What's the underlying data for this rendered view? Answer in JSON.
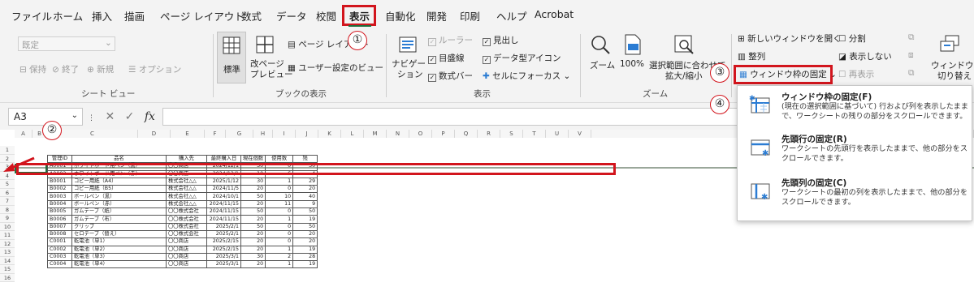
{
  "menubar": {
    "items": [
      "ファイル",
      "ホーム",
      "挿入",
      "描画",
      "ページ レイアウト",
      "数式",
      "データ",
      "校閲",
      "表示",
      "自動化",
      "開発",
      "印刷",
      "ヘルプ",
      "Acrobat"
    ],
    "active": "表示"
  },
  "ribbon": {
    "sheetview": {
      "dropdown": "既定",
      "keep": "保持",
      "exit": "終了",
      "new": "新規",
      "options": "オプション",
      "label": "シート ビュー"
    },
    "bookview": {
      "normal": "標準",
      "pagebreak_1": "改ページ",
      "pagebreak_2": "プレビュー",
      "pagelayout": "ページ レイアウト",
      "custom": "ユーザー設定のビュー",
      "label": "ブックの表示"
    },
    "show": {
      "navigation_1": "ナビゲー",
      "navigation_2": "ション",
      "ruler": "ルーラー",
      "gridlines": "目盛線",
      "formulabar": "数式バー",
      "headings": "見出し",
      "dataicons": "データ型アイコン",
      "focus": "セルにフォーカス",
      "label": "表示"
    },
    "zoom": {
      "zoom": "ズーム",
      "hundred": "100%",
      "fit_1": "選択範囲に合わせて",
      "fit_2": "拡大/縮小",
      "label": "ズーム"
    },
    "window": {
      "newwindow": "新しいウィンドウを開く",
      "split": "分割",
      "arrange": "整列",
      "hide": "表示しない",
      "freeze": "ウィンドウ枠の固定",
      "unhide": "再表示",
      "switch_1": "ウィンドウの",
      "switch_2": "切り替え"
    }
  },
  "formula": {
    "namebox": "A3",
    "cancel": "✕",
    "enter": "✓",
    "fx": "fx"
  },
  "columns": [
    "A",
    "B",
    "C",
    "D",
    "E",
    "F",
    "G",
    "H",
    "I",
    "J",
    "K",
    "L",
    "M",
    "N",
    "O",
    "P",
    "Q",
    "R",
    "S",
    "T",
    "U",
    "V"
  ],
  "rows": [
    "1",
    "2",
    "3",
    "4",
    "5",
    "6",
    "7",
    "8",
    "9",
    "10",
    "11",
    "12",
    "13",
    "14",
    "15",
    "16"
  ],
  "table": {
    "headers": [
      "管理ID",
      "品名",
      "購入先",
      "最終購入日",
      "現在個数",
      "使用数",
      "残"
    ],
    "rows": [
      [
        "A0001",
        "ホワイトボード用ペン（黒）",
        "〇〇商店",
        "2024/12/1",
        "30",
        "0",
        "30"
      ],
      [
        "A0002",
        "ホワイトボード用ペン（赤）",
        "〇〇商店",
        "2024/12/1",
        "10",
        "6",
        "4"
      ],
      [
        "B0001",
        "コピー用紙（A4）",
        "株式会社△△",
        "2025/1/12",
        "30",
        "1",
        "29"
      ],
      [
        "B0002",
        "コピー用紙（B5）",
        "株式会社△△",
        "2024/11/5",
        "20",
        "0",
        "20"
      ],
      [
        "B0003",
        "ボールペン（黒）",
        "株式会社△△",
        "2024/10/1",
        "50",
        "10",
        "40"
      ],
      [
        "B0004",
        "ボールペン（赤）",
        "株式会社△△",
        "2024/11/15",
        "20",
        "11",
        "9"
      ],
      [
        "B0005",
        "ガムテープ（紙）",
        "〇〇株式会社",
        "2024/11/15",
        "50",
        "0",
        "50"
      ],
      [
        "B0006",
        "ガムテープ（布）",
        "〇〇株式会社",
        "2024/11/15",
        "20",
        "1",
        "19"
      ],
      [
        "B0007",
        "クリップ",
        "〇〇株式会社",
        "2025/2/1",
        "50",
        "0",
        "50"
      ],
      [
        "B0008",
        "セロテープ（替え）",
        "〇〇株式会社",
        "2025/2/1",
        "20",
        "0",
        "20"
      ],
      [
        "C0001",
        "乾電池（単1）",
        "〇〇商店",
        "2025/2/15",
        "20",
        "0",
        "20"
      ],
      [
        "C0002",
        "乾電池（単2）",
        "〇〇商店",
        "2025/2/15",
        "20",
        "1",
        "19"
      ],
      [
        "C0003",
        "乾電池（単3）",
        "〇〇商店",
        "2025/3/1",
        "30",
        "2",
        "28"
      ],
      [
        "C0004",
        "乾電池（単4）",
        "〇〇商店",
        "2025/3/1",
        "20",
        "1",
        "19"
      ]
    ]
  },
  "dropdown": {
    "freeze_panes": {
      "title": "ウィンドウ枠の固定(F)",
      "desc": "(現在の選択範囲に基づいて) 行および列を表示したままで、ワークシートの残りの部分をスクロールできます。"
    },
    "freeze_top_row": {
      "title": "先頭行の固定(R)",
      "desc": "ワークシートの先頭行を表示したままで、他の部分をスクロールできます。"
    },
    "freeze_first_col": {
      "title": "先頭列の固定(C)",
      "desc": "ワークシートの最初の列を表示したままで、他の部分をスクロールできます。"
    }
  },
  "annotations": {
    "step1": "①",
    "step2": "②",
    "step3": "③",
    "step4": "④"
  },
  "colors": {
    "highlight": "#d2151d",
    "excel_green": "#1e6f3c",
    "freeze_icon": "#2b7cd3"
  }
}
